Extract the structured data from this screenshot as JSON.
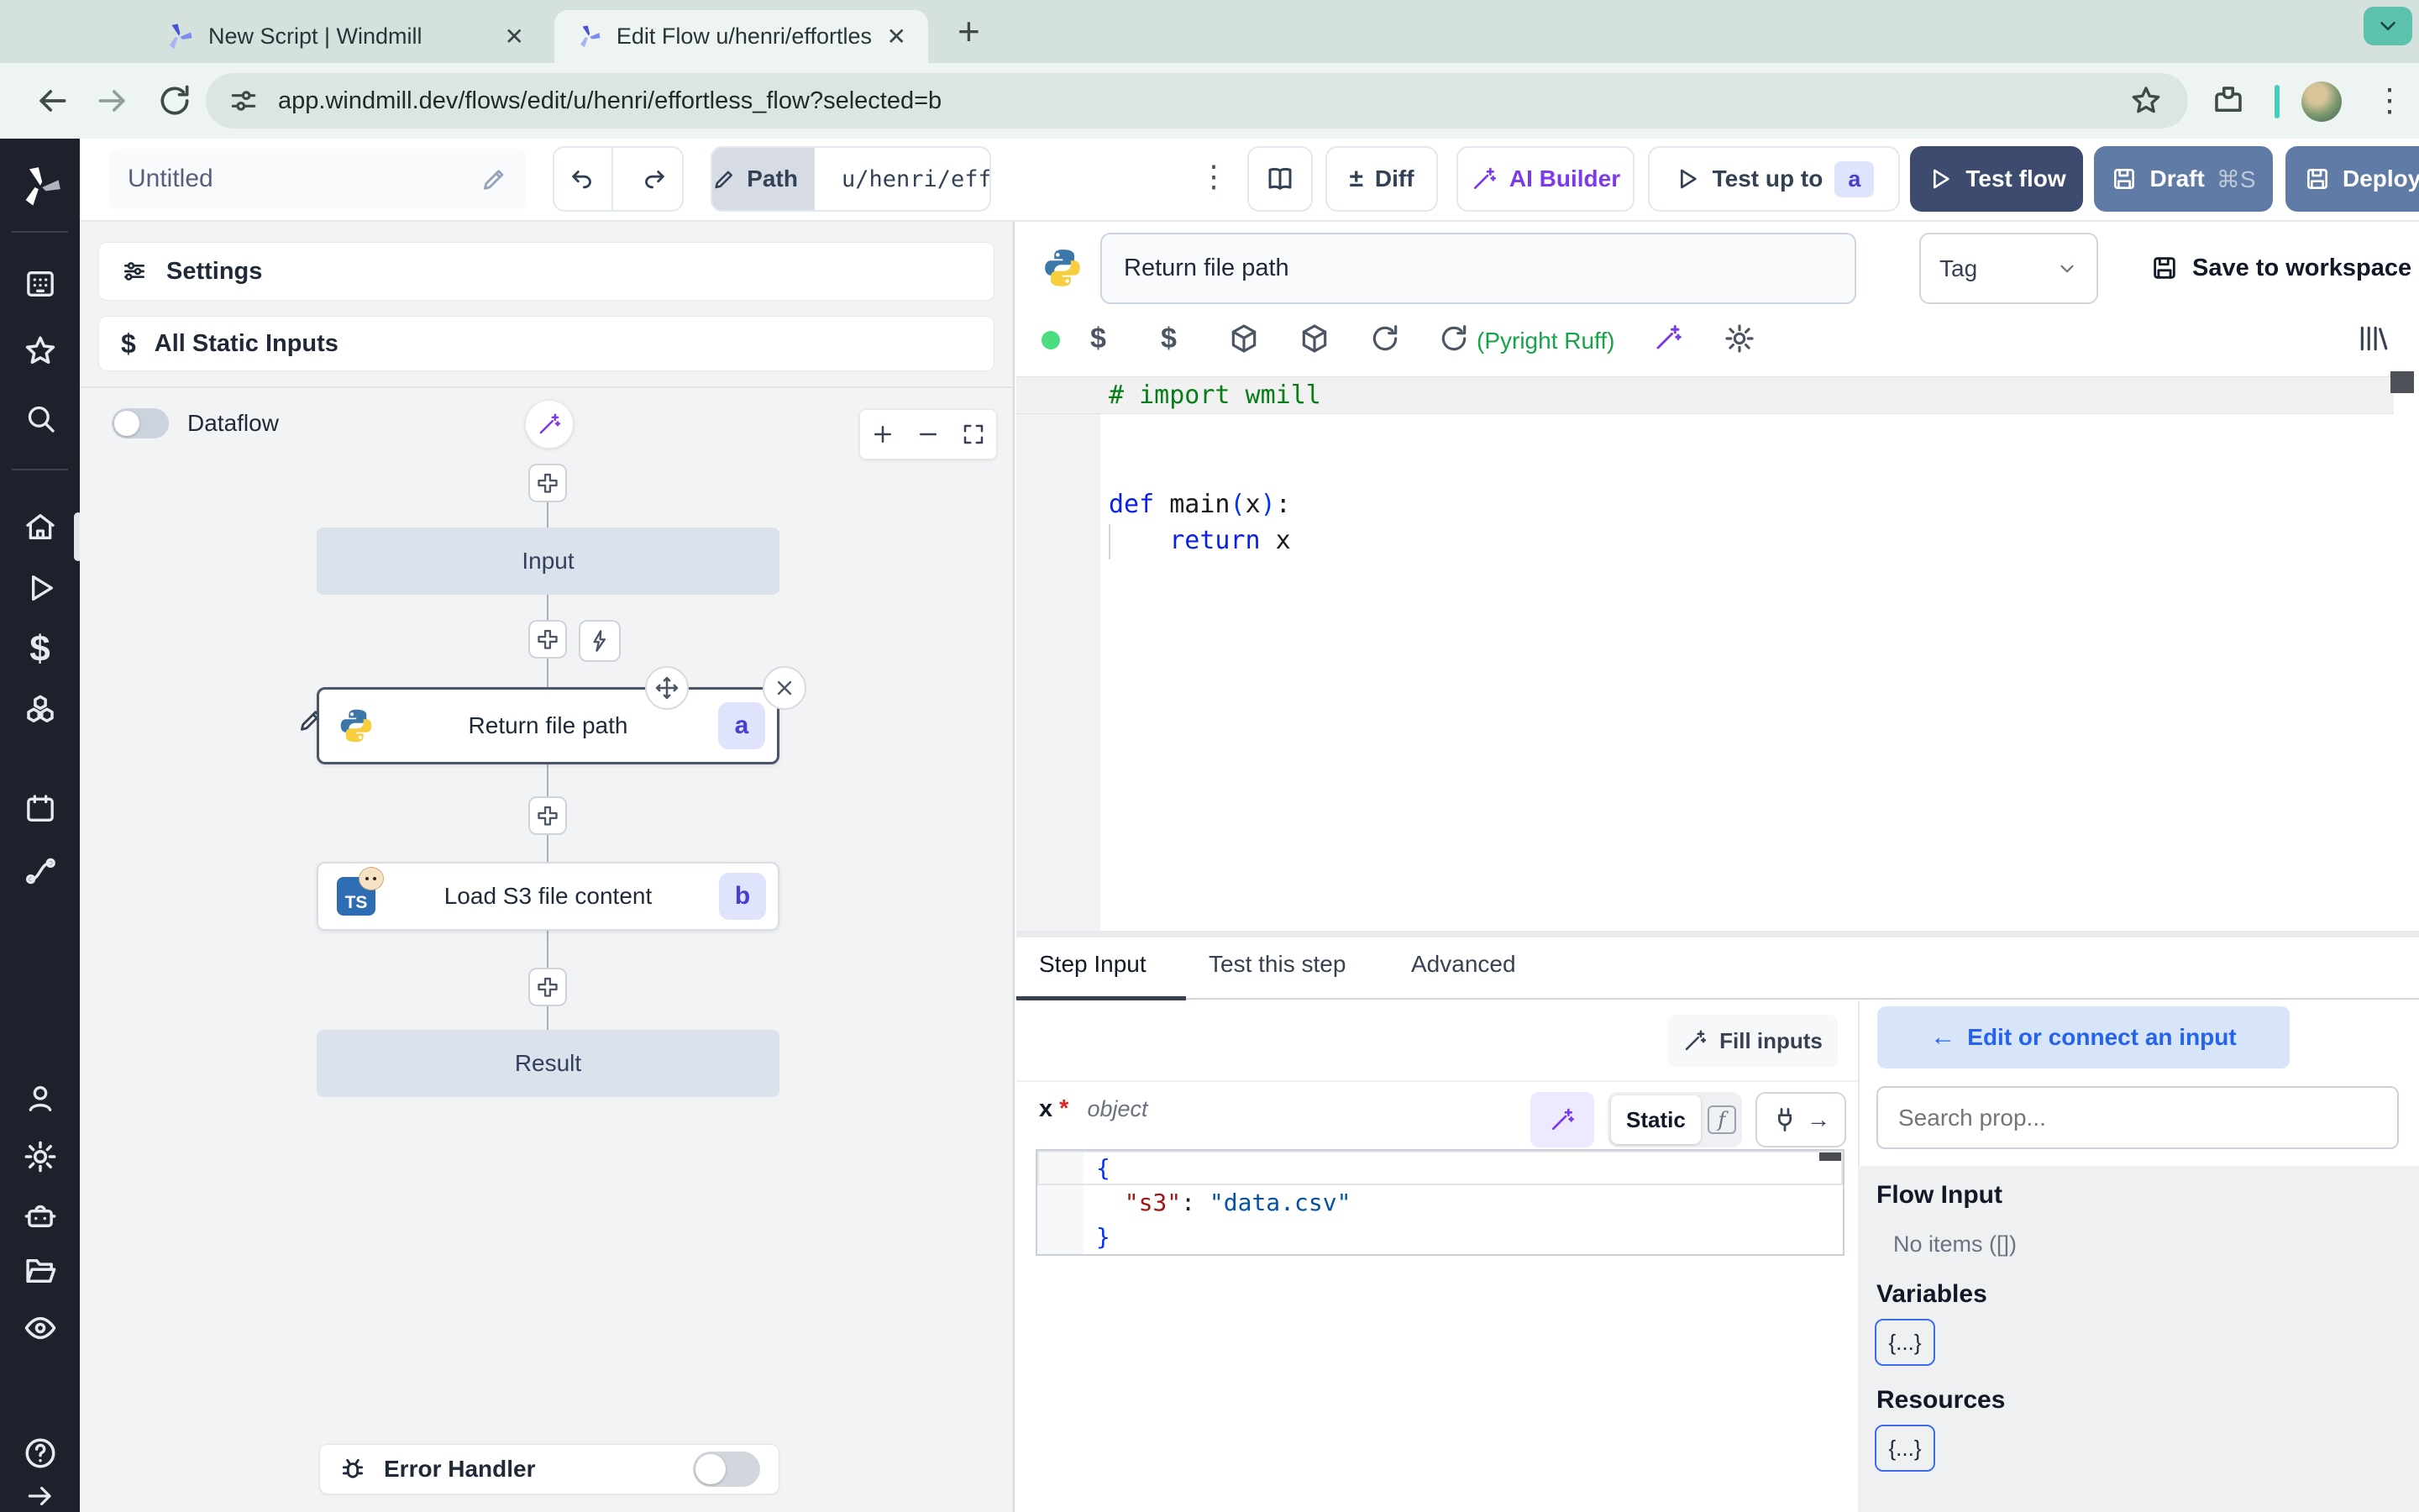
{
  "colors": {
    "accent_blue": "#2563eb",
    "accent_purple": "#7c3aed",
    "badge_bg": "#dfe3fb",
    "badge_text": "#4540cf",
    "test_flow_bg": "#3d4b6e",
    "deploy_bg": "#607ca6",
    "chrome_frame": "#d5e1dd",
    "chrome_toolbar": "#eef4f1",
    "sidebar_bg": "#1d212b",
    "lint_green": "#16a34a"
  },
  "browser": {
    "tabs": [
      {
        "title": "New Script | Windmill",
        "icon": "windmill-logo"
      },
      {
        "title": "Edit Flow u/henri/effortless_fl",
        "icon": "windmill-logo"
      }
    ],
    "close_glyph": "✕",
    "new_tab_glyph": "+",
    "url": "app.windmill.dev/flows/edit/u/henri/effortless_flow?selected=b",
    "kebab_glyph": "⋮"
  },
  "sidebar": {
    "icons": [
      "windmill-logo",
      "apps",
      "favorites",
      "search",
      "home",
      "runs",
      "variables",
      "resources",
      "schedules",
      "triggers",
      "user",
      "settings",
      "workers",
      "folders",
      "audit",
      "help",
      "expand"
    ]
  },
  "topbar": {
    "flow_name": "Untitled",
    "path_label": "Path",
    "path_value": "u/henri/eff",
    "kebab_glyph": "⋮",
    "diff_pm": "±",
    "diff_label": "Diff",
    "ai_builder_label": "AI Builder",
    "test_up_to_label": "Test up to",
    "test_up_to_badge": "a",
    "test_flow_label": "Test flow",
    "draft_label": "Draft",
    "draft_shortcut": "⌘S",
    "deploy_label": "Deploy"
  },
  "flow_panel": {
    "settings_label": "Settings",
    "all_static_inputs_label": "All Static Inputs",
    "dataflow_label": "Dataflow",
    "nodes": {
      "input": "Input",
      "step_a": {
        "label": "Return file path",
        "badge": "a",
        "lang": "python"
      },
      "step_b": {
        "label": "Load S3 file content",
        "badge": "b",
        "lang": "TS"
      },
      "result": "Result"
    },
    "error_handler_label": "Error Handler"
  },
  "step": {
    "name": "Return file path",
    "tag_placeholder": "Tag",
    "save_label": "Save to workspace",
    "lint_status": "(Pyright Ruff)"
  },
  "code": {
    "lines": [
      [
        [
          "cmt",
          "# import wmill"
        ]
      ],
      [],
      [],
      [
        [
          "kw",
          "def"
        ],
        [
          "pl",
          " "
        ],
        [
          "pl",
          "main"
        ],
        [
          "br",
          "("
        ],
        [
          "pl",
          "x"
        ],
        [
          "br",
          ")"
        ],
        [
          "pl",
          ":"
        ]
      ],
      [
        [
          "pl",
          "    "
        ],
        [
          "kw",
          "return"
        ],
        [
          "pl",
          " x"
        ]
      ]
    ]
  },
  "bottom": {
    "tabs": [
      "Step Input",
      "Test this step",
      "Advanced"
    ],
    "fill_inputs_label": "Fill inputs",
    "arg_name": "x",
    "arg_required": "*",
    "arg_type": "object",
    "static_label": "Static",
    "fn_glyph": "f",
    "plug_arrow": "→",
    "json_lines": [
      [
        [
          "br",
          "{"
        ]
      ],
      [
        [
          "pl",
          "  "
        ],
        [
          "key",
          "\"s3\""
        ],
        [
          "pl",
          ": "
        ],
        [
          "str",
          "\"data.csv\""
        ]
      ],
      [
        [
          "br",
          "}"
        ]
      ]
    ],
    "edit_connect_arrow": "←",
    "edit_connect_label": "Edit or connect an input",
    "search_placeholder": "Search prop...",
    "flow_input_label": "Flow Input",
    "no_items_label": "No items ([])",
    "variables_label": "Variables",
    "resources_label": "Resources",
    "braces_label": "{...}"
  }
}
